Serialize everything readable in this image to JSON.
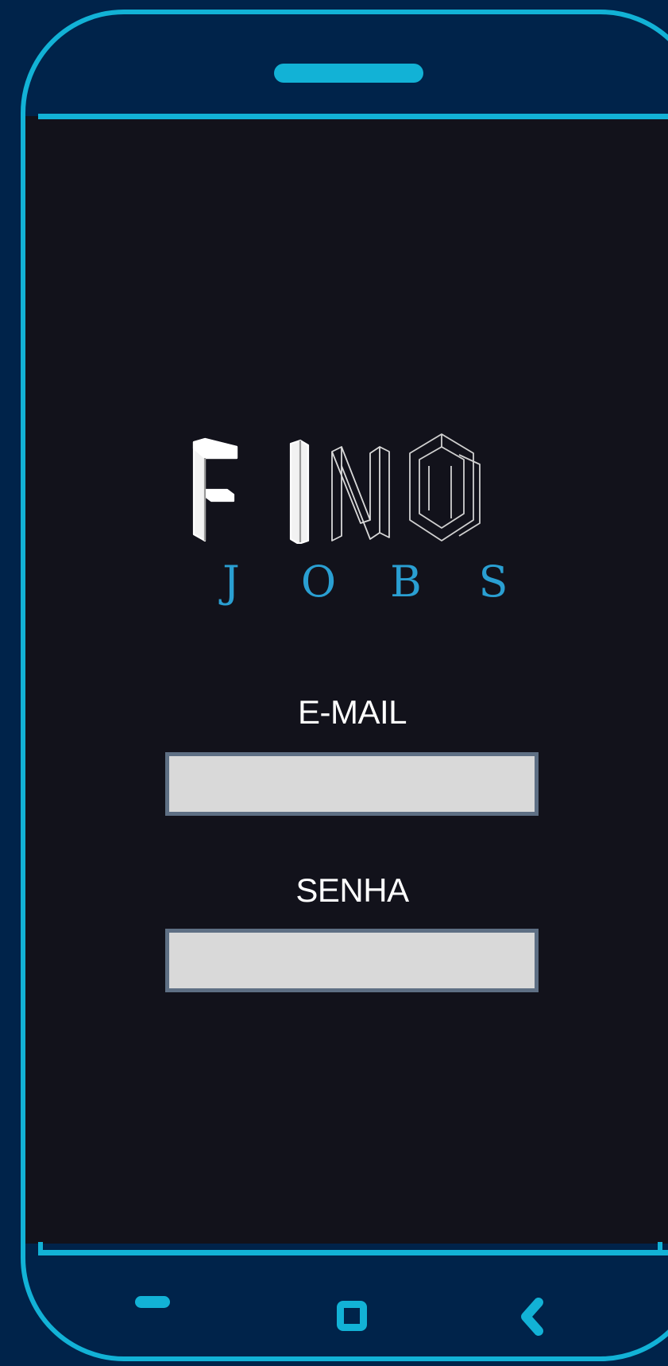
{
  "app": {
    "logo_word": "FIND",
    "logo_sub": [
      "J",
      "O",
      "B",
      "S"
    ]
  },
  "form": {
    "email_label": "E-MAIL",
    "email_value": "",
    "password_label": "SENHA",
    "password_value": ""
  },
  "navbar": {
    "recents_icon": "recents-icon",
    "home_icon": "home-icon",
    "back_icon": "back-icon"
  },
  "colors": {
    "frame_accent": "#12b2d6",
    "background_outer": "#00234a",
    "screen_background": "#12121b",
    "logo_sub_color": "#2a9fd2",
    "input_background": "#d9d9d9",
    "input_border": "#5e6f84"
  }
}
